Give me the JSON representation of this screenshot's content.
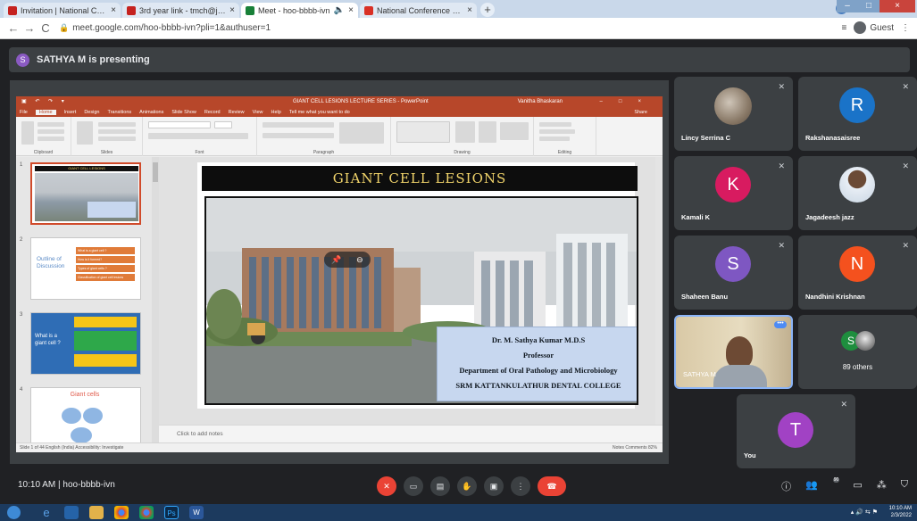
{
  "browser": {
    "tabs": [
      {
        "title": "Invitation | National Conference",
        "color": "#c5221f",
        "active": false
      },
      {
        "title": "3rd year link - tmch@jerusalem.c",
        "color": "#c5221f",
        "active": false
      },
      {
        "title": "Meet - hoo-bbbb-ivn",
        "color": "#188038",
        "active": true
      },
      {
        "title": "National Conference on Current",
        "color": "#d93025",
        "active": false
      }
    ],
    "new_tab": "+",
    "url": "meet.google.com/hoo-bbbb-ivn?pli=1&authuser=1",
    "profile_label": "Guest"
  },
  "meet": {
    "presenting_initial": "S",
    "presenting_text": "SATHYA M is presenting",
    "time_code": "10:10 AM  |  hoo-bbbb-ivn"
  },
  "ppt": {
    "doc_title": "GIANT CELL LESIONS LECTURE SERIES - PowerPoint",
    "user": "Vanitha Bhaskaran",
    "menu": [
      "File",
      "Home",
      "Insert",
      "Design",
      "Transitions",
      "Animations",
      "Slide Show",
      "Record",
      "Review",
      "View",
      "Help",
      "Tell me what you want to do"
    ],
    "share": "Share",
    "ribbon_groups": [
      "Clipboard",
      "Slides",
      "Font",
      "Paragraph",
      "Drawing",
      "Editing"
    ],
    "thumbnails": [
      {
        "num": "1",
        "title": "GIANT CELL LESIONS"
      },
      {
        "num": "2",
        "title": "Outline of Discussion",
        "items": [
          "What is a giant cell ?",
          "How is it formed?",
          "Types of giant cells ?",
          "Classification of giant cell lesions"
        ]
      },
      {
        "num": "3",
        "title": "What is a giant cell ?"
      },
      {
        "num": "4",
        "title": "Giant cells"
      }
    ],
    "slide_title": "GIANT CELL LESIONS",
    "credit": [
      "Dr. M. Sathya Kumar  M.D.S",
      "Professor",
      "Department of Oral Pathology and Microbiology",
      "SRM KATTANKULATHUR DENTAL COLLEGE"
    ],
    "notes_placeholder": "Click to add notes",
    "status_left": "Slide 1 of 44    English (India)    Accessibility: Investigate",
    "status_right": "Notes    Comments    82%"
  },
  "participants": [
    {
      "name": "Lincy Serrina C",
      "type": "photo"
    },
    {
      "name": "Rakshanasaisree",
      "initial": "R",
      "color": "#1a73c8"
    },
    {
      "name": "Kamali K",
      "initial": "K",
      "color": "#d81b60"
    },
    {
      "name": "Jagadeesh jazz",
      "type": "photo"
    },
    {
      "name": "Shaheen Banu",
      "initial": "S",
      "color": "#7e57c2"
    },
    {
      "name": "Nandhini Krishnan",
      "initial": "N",
      "color": "#f4511e"
    },
    {
      "name": "SATHYA M",
      "type": "video"
    },
    {
      "name": "89 others",
      "initial": "S",
      "color": "#1e8e3e"
    },
    {
      "name": "You",
      "initial": "T",
      "color": "#a142c4"
    }
  ],
  "others_count_badge": "90",
  "taskbar": {
    "time": "10:10 AM",
    "date": "2/3/2022"
  }
}
